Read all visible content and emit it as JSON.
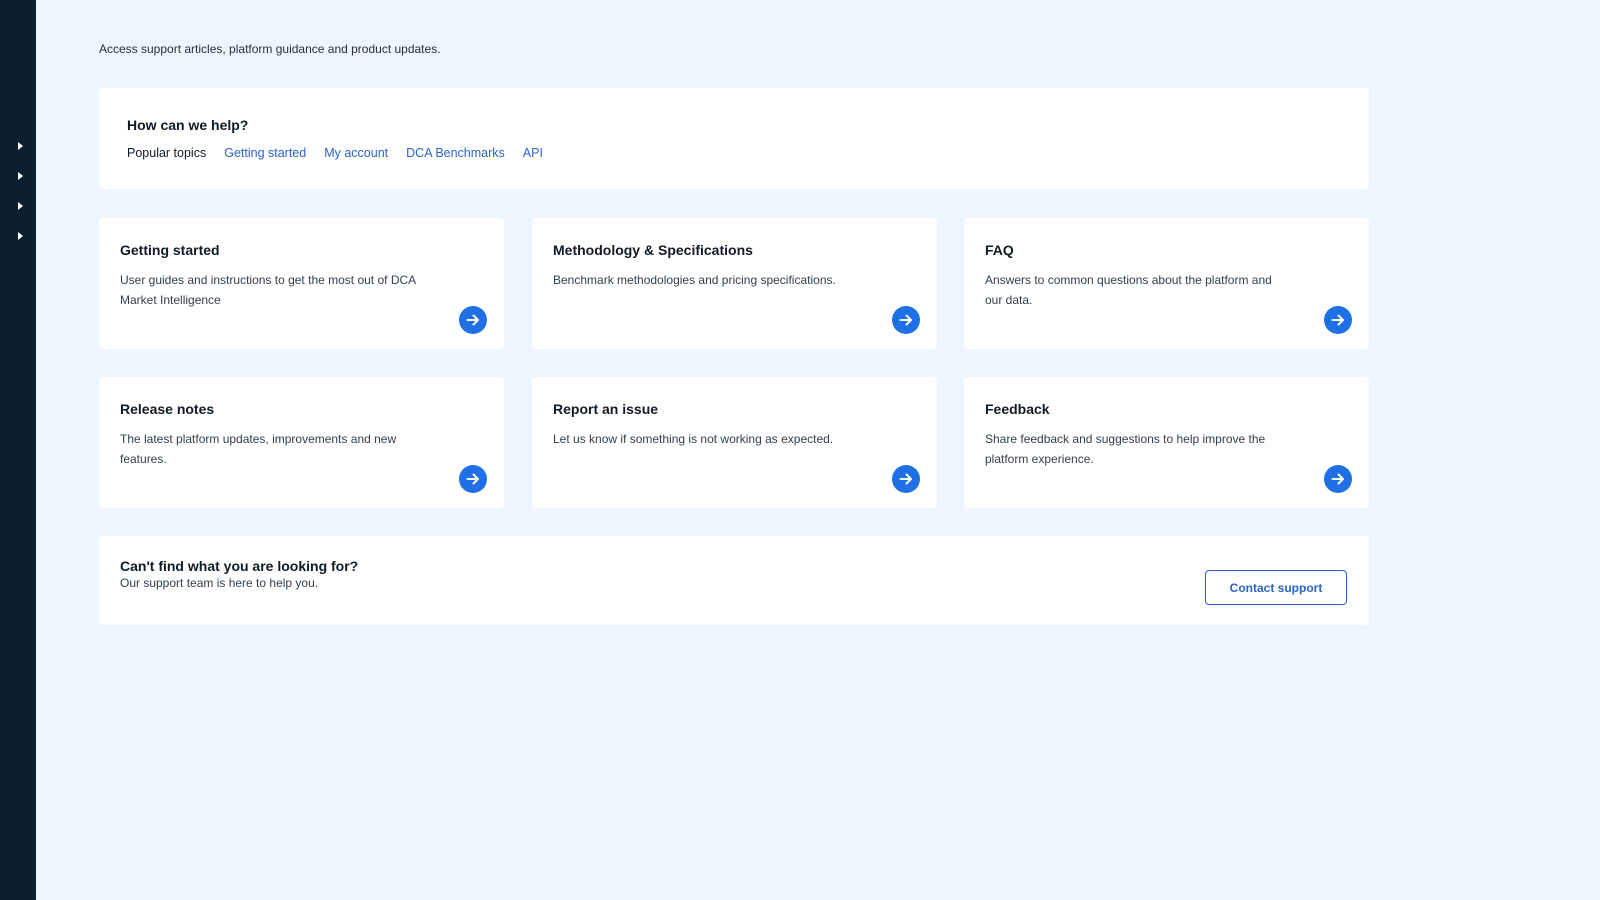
{
  "intro_text": "Access support articles, platform guidance and product updates.",
  "help": {
    "title": "How can we help?",
    "popular_label": "Popular topics",
    "topics": [
      "Getting started",
      "My account",
      "DCA Benchmarks",
      "API"
    ]
  },
  "cards": [
    {
      "title": "Getting started",
      "description": "User guides and instructions to get the most out of DCA Market Intelligence",
      "icon": "arrow-right-icon"
    },
    {
      "title": "Methodology & Specifications",
      "description": "Benchmark methodologies and pricing specifications.",
      "icon": "arrow-right-icon"
    },
    {
      "title": "FAQ",
      "description": "Answers to common questions about the platform and our data.",
      "icon": "arrow-right-icon"
    },
    {
      "title": "Release notes",
      "description": "The latest platform updates, improvements and new features.",
      "icon": "arrow-right-icon"
    },
    {
      "title": "Report an issue",
      "description": "Let us know if something is not working as expected.",
      "icon": "arrow-right-icon"
    },
    {
      "title": "Feedback",
      "description": "Share feedback and suggestions to help improve the platform experience.",
      "icon": "arrow-right-icon"
    }
  ],
  "footer": {
    "title": "Can't find what you are looking for?",
    "subtitle": "Our support team is here to help you.",
    "button_label": "Contact support"
  },
  "sidebar": {
    "items": [
      {
        "icon": "caret-right-icon"
      },
      {
        "icon": "caret-right-icon"
      },
      {
        "icon": "caret-right-icon"
      },
      {
        "icon": "caret-right-icon"
      }
    ]
  },
  "colors": {
    "accent": "#1f6fe5",
    "link": "#2c63c8",
    "sidebar_bg": "#0a1f30",
    "page_bg": "#eef5fd",
    "card_bg": "#ffffff"
  }
}
